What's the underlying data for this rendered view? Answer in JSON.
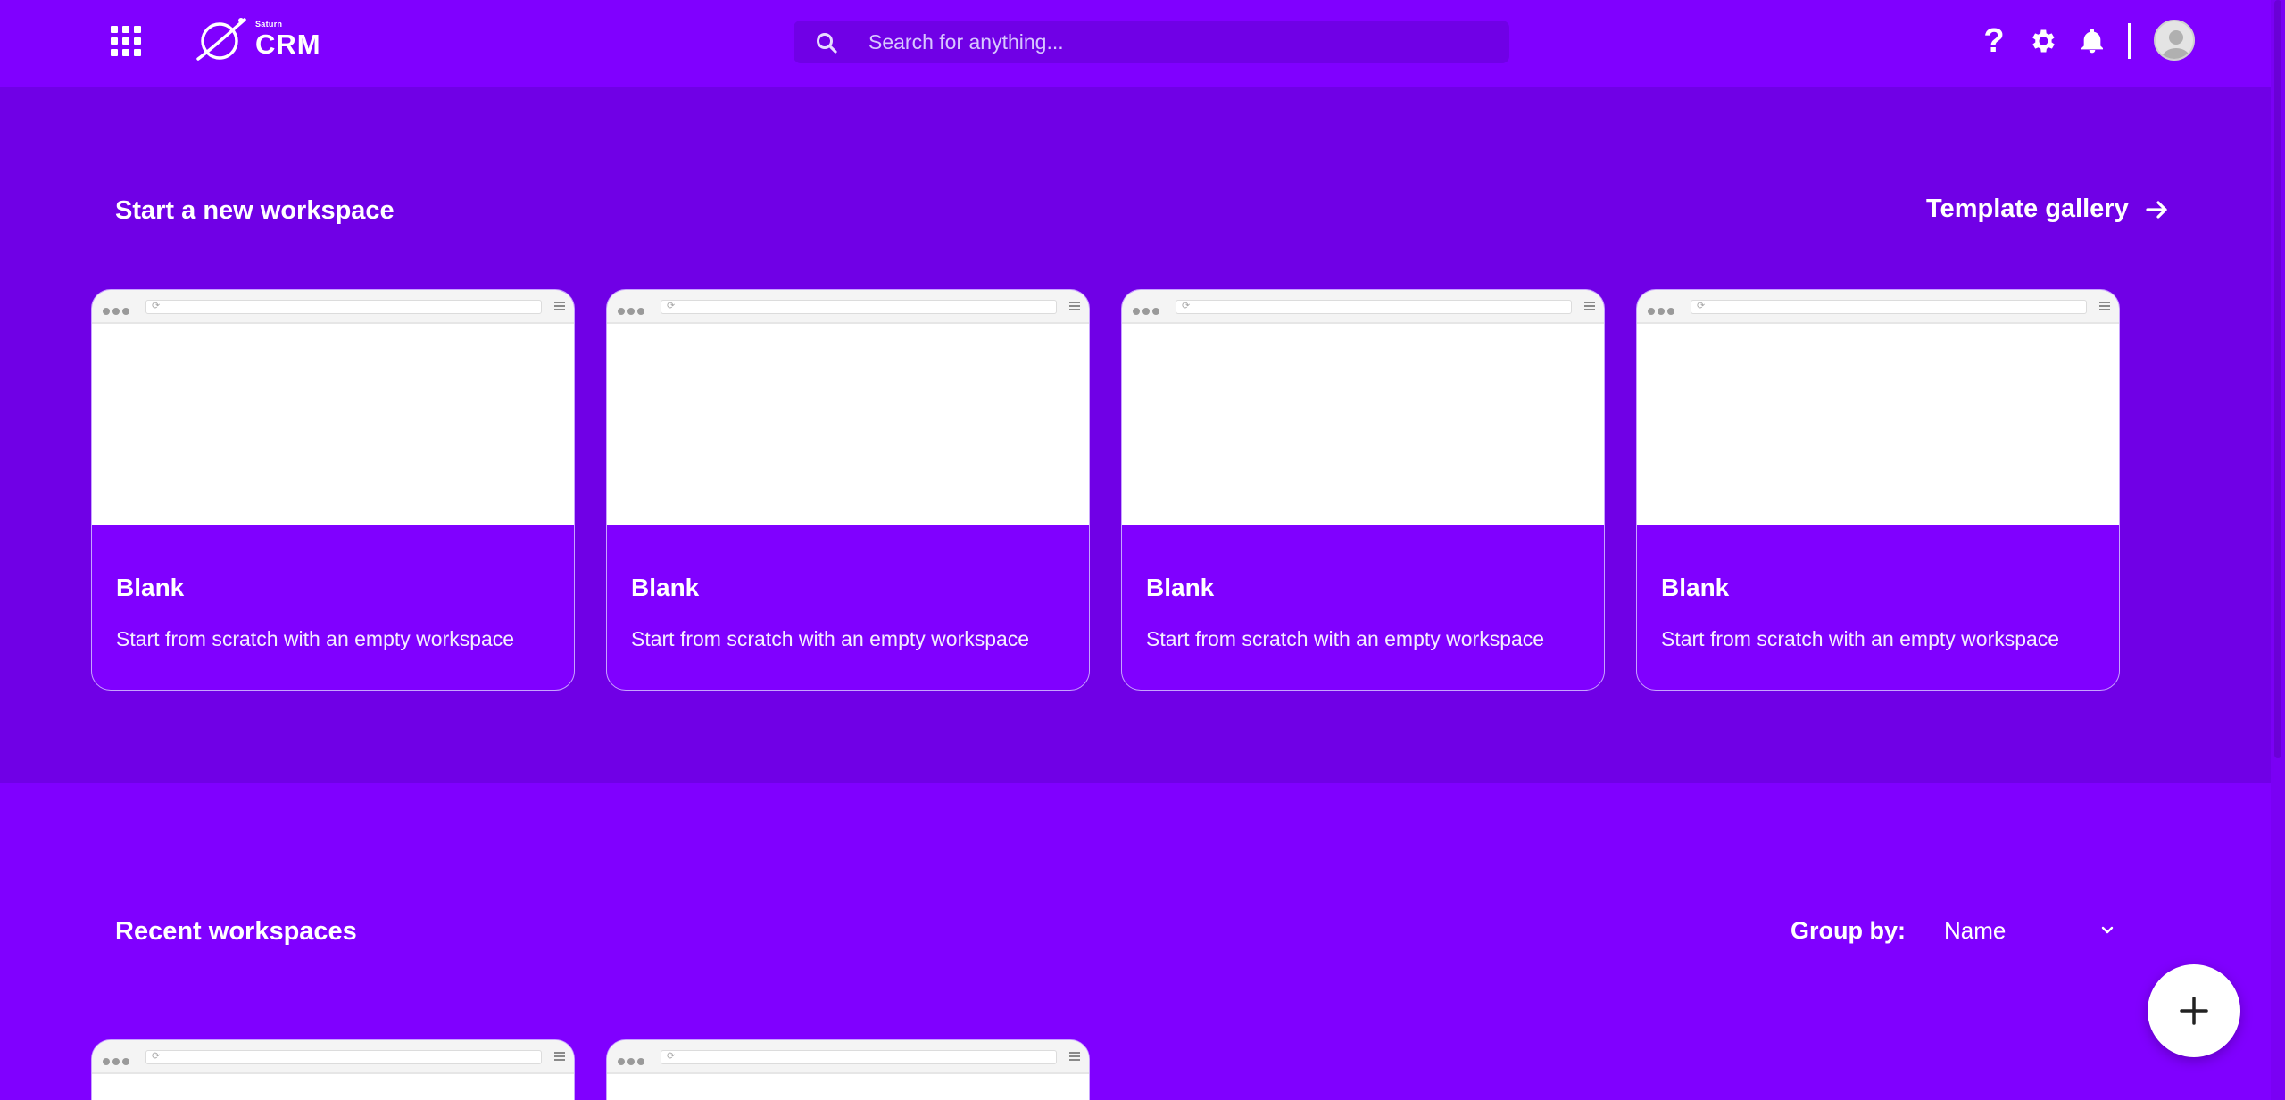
{
  "header": {
    "logo_small": "Saturn",
    "logo_big": "CRM",
    "search_placeholder": "Search for anything...",
    "help_label": "?"
  },
  "new_workspace": {
    "title": "Start a new workspace",
    "template_gallery_label": "Template gallery",
    "cards": [
      {
        "title": "Blank",
        "description": "Start from scratch with an empty workspace"
      },
      {
        "title": "Blank",
        "description": "Start from scratch with an empty workspace"
      },
      {
        "title": "Blank",
        "description": "Start from scratch with an empty workspace"
      },
      {
        "title": "Blank",
        "description": "Start from scratch with an empty workspace"
      }
    ]
  },
  "recent": {
    "title": "Recent workspaces",
    "group_by_label": "Group by:",
    "group_by_value": "Name"
  },
  "colors": {
    "brand": "#8000ff",
    "section_bg": "#7000e6"
  },
  "icons": [
    "apps-grid-icon",
    "saturn-logo-icon",
    "search-icon",
    "help-icon",
    "gear-icon",
    "bell-icon",
    "avatar-icon",
    "arrow-right-icon",
    "chevron-down-icon",
    "plus-icon"
  ]
}
